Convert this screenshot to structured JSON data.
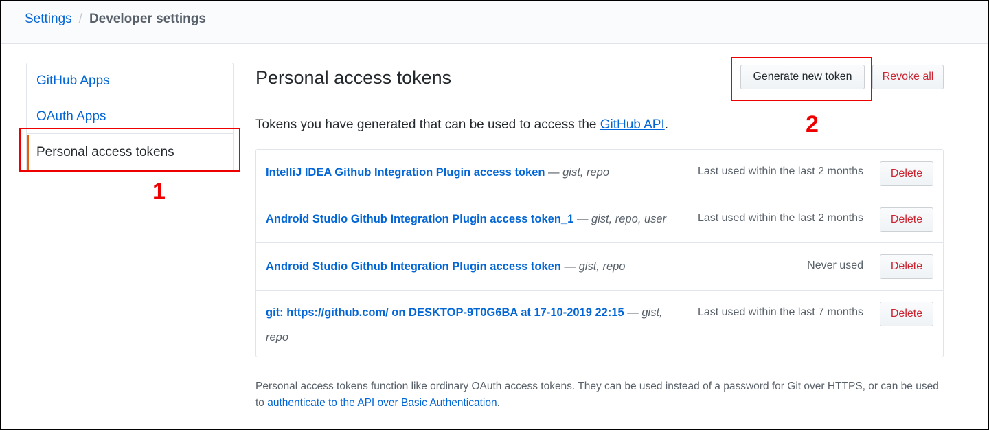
{
  "breadcrumb": {
    "parent": "Settings",
    "separator": "/",
    "current": "Developer settings"
  },
  "sidebar": {
    "items": [
      {
        "label": "GitHub Apps"
      },
      {
        "label": "OAuth Apps"
      },
      {
        "label": "Personal access tokens",
        "selected": true
      }
    ]
  },
  "annotations": {
    "marker_1": "1",
    "marker_2": "2",
    "color": "#e00000"
  },
  "main": {
    "title": "Personal access tokens",
    "generate_label": "Generate new token",
    "revoke_label": "Revoke all",
    "intro_prefix": "Tokens you have generated that can be used to access the ",
    "intro_link": "GitHub API",
    "intro_suffix": "."
  },
  "tokens": [
    {
      "name": "IntelliJ IDEA Github Integration Plugin access token",
      "scopes": " — gist, repo",
      "last_used": "Last used within the last 2 months",
      "delete_label": "Delete"
    },
    {
      "name": "Android Studio Github Integration Plugin access token_1",
      "scopes": " — gist, repo, user",
      "last_used": "Last used within the last 2 months",
      "delete_label": "Delete"
    },
    {
      "name": "Android Studio Github Integration Plugin access token",
      "scopes": " — gist, repo",
      "last_used": "Never used",
      "delete_label": "Delete"
    },
    {
      "name": "git: https://github.com/ on DESKTOP-9T0G6BA at 17-10-2019 22:15",
      "scopes": " — gist, repo",
      "last_used": "Last used within the last 7 months",
      "delete_label": "Delete"
    }
  ],
  "footnote": {
    "text": "Personal access tokens function like ordinary OAuth access tokens. They can be used instead of a password for Git over HTTPS, or can be used to ",
    "link": "authenticate to the API over Basic Authentication",
    "suffix": "."
  },
  "colors": {
    "link": "#0366d6",
    "danger": "#cb2431",
    "selected_accent": "#e36209"
  }
}
